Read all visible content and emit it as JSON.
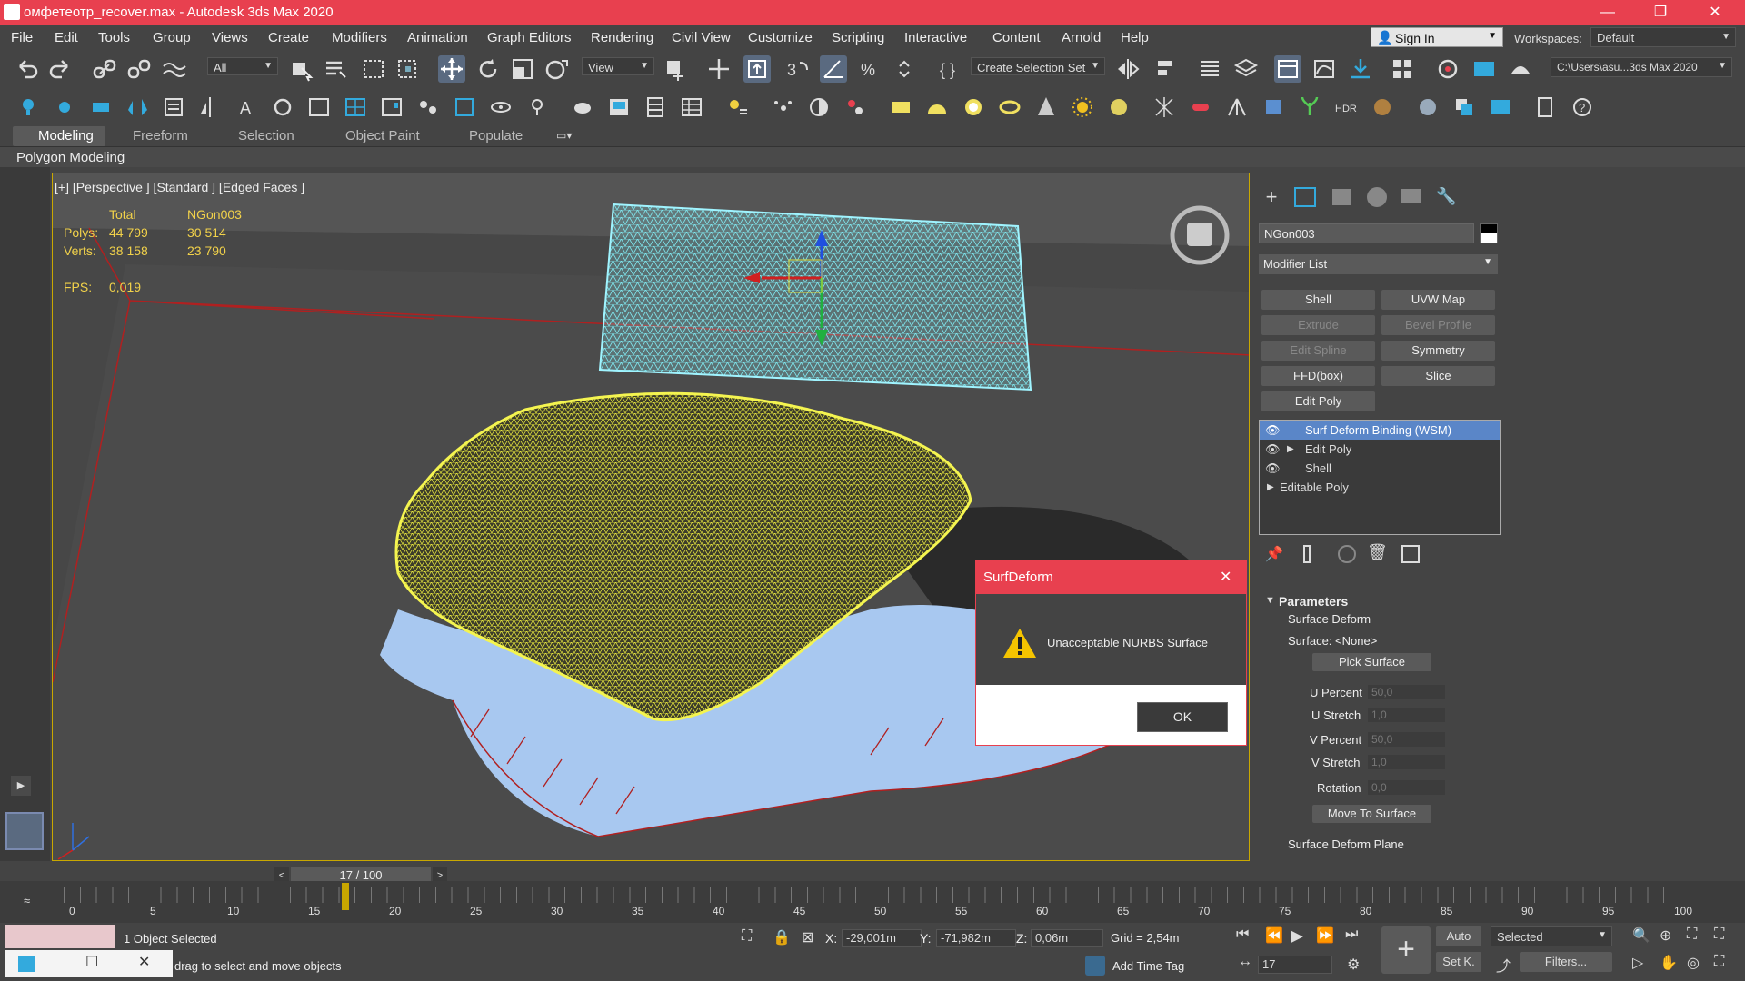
{
  "window": {
    "title": "омфетеотр_recover.max - Autodesk 3ds Max 2020",
    "minimize": "—",
    "restore": "❐",
    "close": "✕"
  },
  "menu": [
    "File",
    "Edit",
    "Tools",
    "Group",
    "Views",
    "Create",
    "Modifiers",
    "Animation",
    "Graph Editors",
    "Rendering",
    "Civil View",
    "Customize",
    "Scripting",
    "Interactive",
    "Content",
    "Arnold",
    "Help"
  ],
  "account": {
    "signin": "Sign In",
    "workspaces_label": "Workspaces:",
    "workspace": "Default"
  },
  "toolbar": {
    "filter": "All",
    "refcoord": "View",
    "selection_set": "Create Selection Set",
    "path": "C:\\Users\\asu...3ds Max 2020"
  },
  "ribbon": {
    "tabs": [
      "Modeling",
      "Freeform",
      "Selection",
      "Object Paint",
      "Populate"
    ],
    "sub": "Polygon Modeling"
  },
  "viewport": {
    "label": "[+] [Perspective ] [Standard ] [Edged Faces ]",
    "stats": {
      "total_h": "Total",
      "obj_h": "NGon003",
      "polys_l": "Polys:",
      "polys_total": "44 799",
      "polys_obj": "30 514",
      "verts_l": "Verts:",
      "verts_total": "38 158",
      "verts_obj": "23 790",
      "fps_l": "FPS:",
      "fps": "0,019"
    }
  },
  "panel": {
    "object_name": "NGon003",
    "modifier_list": "Modifier List",
    "buttons": [
      "Shell",
      "UVW Map",
      "Extrude",
      "Bevel Profile",
      "Edit Spline",
      "Symmetry",
      "FFD(box)",
      "Slice",
      "Edit Poly"
    ],
    "stack": [
      "Surf Deform Binding (WSM)",
      "Edit Poly",
      "Shell",
      "Editable Poly"
    ],
    "params_title": "Parameters",
    "group1": "Surface Deform",
    "surface_label": "Surface: <None>",
    "pick_surface": "Pick Surface",
    "u_percent": "U Percent",
    "u_percent_v": "50,0",
    "u_stretch": "U Stretch",
    "u_stretch_v": "1,0",
    "v_percent": "V Percent",
    "v_percent_v": "50,0",
    "v_stretch": "V Stretch",
    "v_stretch_v": "1,0",
    "rotation": "Rotation",
    "rotation_v": "0,0",
    "move_to_surface": "Move To Surface",
    "group2": "Surface Deform Plane"
  },
  "dialog": {
    "title": "SurfDeform",
    "message": "Unacceptable NURBS Surface",
    "ok": "OK",
    "close": "✕"
  },
  "timeline": {
    "frame": "17 / 100",
    "ticks": [
      "0",
      "5",
      "10",
      "15",
      "20",
      "25",
      "30",
      "35",
      "40",
      "45",
      "50",
      "55",
      "60",
      "65",
      "70",
      "75",
      "80",
      "85",
      "90",
      "95",
      "100"
    ]
  },
  "status": {
    "selected": "1 Object Selected",
    "prompt": "drag to select and move objects",
    "x_l": "X:",
    "x": "-29,001m",
    "y_l": "Y:",
    "y": "-71,982m",
    "z_l": "Z:",
    "z": "0,06m",
    "grid": "Grid = 2,54m",
    "add_time_tag": "Add Time Tag",
    "frame": "17",
    "auto": "Auto",
    "set_key": "Set K.",
    "selected_dd": "Selected",
    "filters": "Filters..."
  },
  "colors": {
    "accent": "#e8404f",
    "selection": "#f0f040",
    "wire": "#7fe8f0",
    "shape": "#a8c8f0"
  }
}
